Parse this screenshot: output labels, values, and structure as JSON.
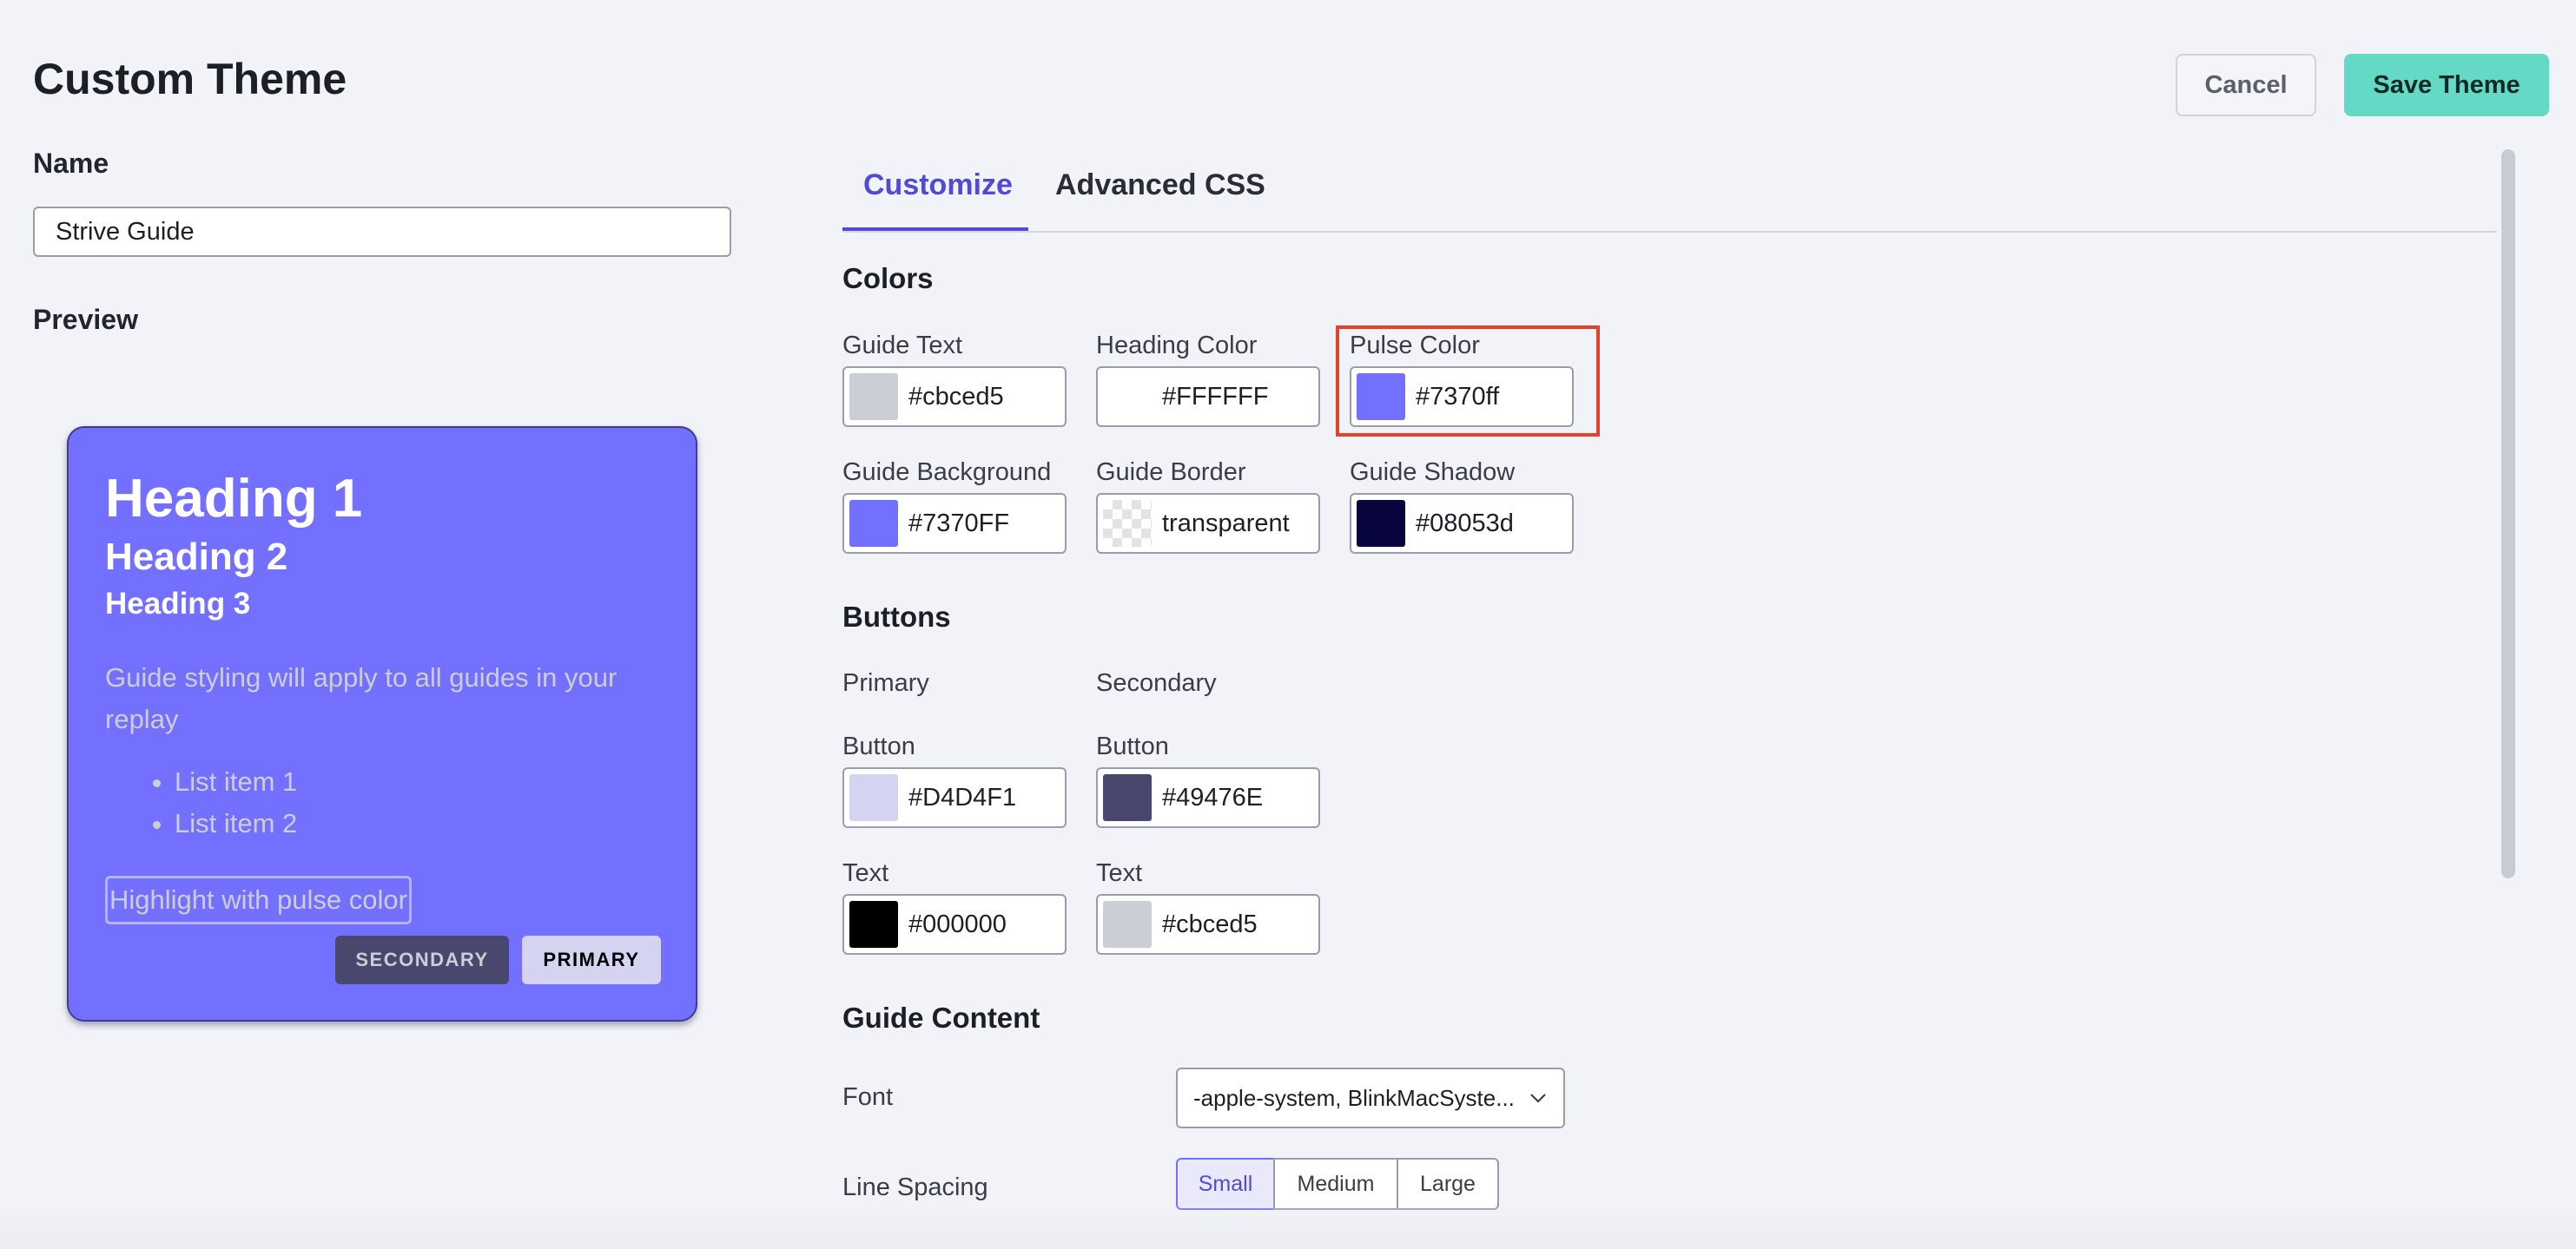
{
  "header": {
    "title": "Custom Theme",
    "cancel_label": "Cancel",
    "save_label": "Save Theme"
  },
  "name_field": {
    "label": "Name",
    "value": "Strive Guide"
  },
  "preview": {
    "label": "Preview",
    "heading1": "Heading 1",
    "heading2": "Heading 2",
    "heading3": "Heading 3",
    "body_text": "Guide styling will apply to all guides in your replay",
    "list_items": [
      "List item 1",
      "List item 2"
    ],
    "highlight_text": "Highlight with pulse color",
    "secondary_button": "SECONDARY",
    "primary_button": "PRIMARY"
  },
  "tabs": [
    {
      "label": "Customize",
      "active": true
    },
    {
      "label": "Advanced CSS",
      "active": false
    }
  ],
  "colors": {
    "title": "Colors",
    "fields": [
      {
        "label": "Guide Text",
        "value": "#cbced5",
        "swatch": "#cbced5"
      },
      {
        "label": "Heading Color",
        "value": "#FFFFFF",
        "swatch": "#FFFFFF"
      },
      {
        "label": "Pulse Color",
        "value": "#7370ff",
        "swatch": "#7370ff"
      },
      {
        "label": "Guide Background",
        "value": "#7370FF",
        "swatch": "#7370FF"
      },
      {
        "label": "Guide Border",
        "value": "transparent",
        "swatch": "transparent"
      },
      {
        "label": "Guide Shadow",
        "value": "#08053d",
        "swatch": "#08053d"
      }
    ]
  },
  "buttons": {
    "title": "Buttons",
    "primary_label": "Primary",
    "secondary_label": "Secondary",
    "primary_button": {
      "label": "Button",
      "value": "#D4D4F1",
      "swatch": "#D4D4F1"
    },
    "secondary_button": {
      "label": "Button",
      "value": "#49476E",
      "swatch": "#49476E"
    },
    "primary_text": {
      "label": "Text",
      "value": "#000000",
      "swatch": "#000000"
    },
    "secondary_text": {
      "label": "Text",
      "value": "#cbced5",
      "swatch": "#cbced5"
    }
  },
  "guide_content": {
    "title": "Guide Content",
    "font_label": "Font",
    "font_value": "-apple-system, BlinkMacSyste...",
    "line_spacing_label": "Line Spacing",
    "line_spacing_options": [
      "Small",
      "Medium",
      "Large"
    ],
    "line_spacing_selected": "Small"
  }
}
